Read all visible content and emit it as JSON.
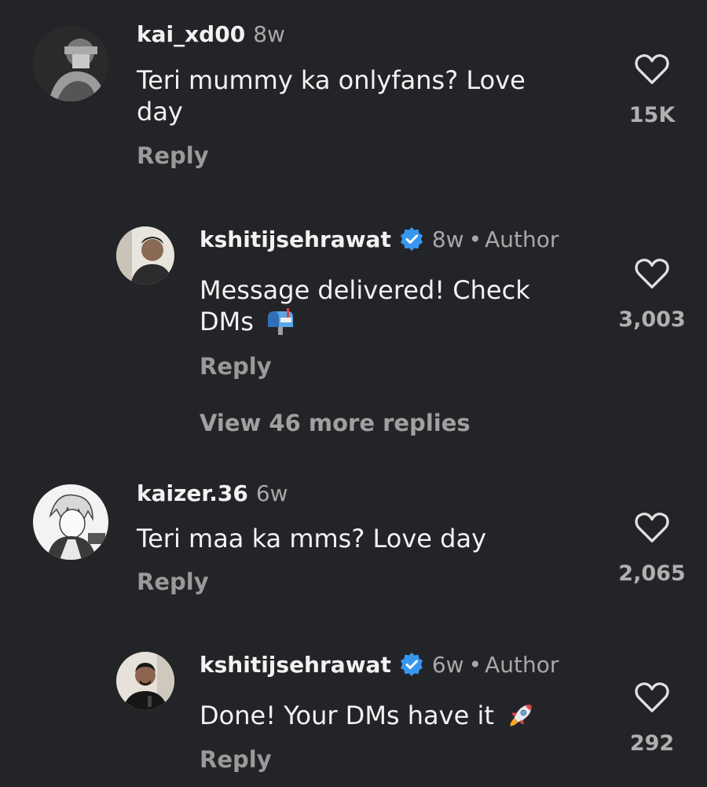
{
  "comments": [
    {
      "username": "kai_xd00",
      "time": "8w",
      "text": "Teri mummy ka onlyfans? Love day",
      "reply_label": "Reply",
      "likes": "15K",
      "avatar_icon": "mono-portrait-avatar"
    },
    {
      "username": "kshitijsehrawat",
      "verified": true,
      "time": "8w",
      "separator": "•",
      "author_badge": "Author",
      "text": "Message delivered! Check DMs",
      "emoji": "mailbox-emoji",
      "reply_label": "Reply",
      "likes": "3,003",
      "avatar_icon": "man-portrait-avatar"
    },
    {
      "username": "kaizer.36",
      "time": "6w",
      "text": "Teri maa ka mms? Love day",
      "reply_label": "Reply",
      "likes": "2,065",
      "avatar_icon": "anime-sketch-avatar"
    },
    {
      "username": "kshitijsehrawat",
      "verified": true,
      "time": "6w",
      "separator": "•",
      "author_badge": "Author",
      "text": "Done! Your DMs have it",
      "emoji": "rocket-emoji",
      "reply_label": "Reply",
      "likes": "292",
      "avatar_icon": "man-portrait-avatar"
    }
  ],
  "view_more_replies": "View 46 more replies",
  "colors": {
    "background": "#232427",
    "verified_blue": "#3797f0",
    "muted_text": "#a8a8a8"
  }
}
